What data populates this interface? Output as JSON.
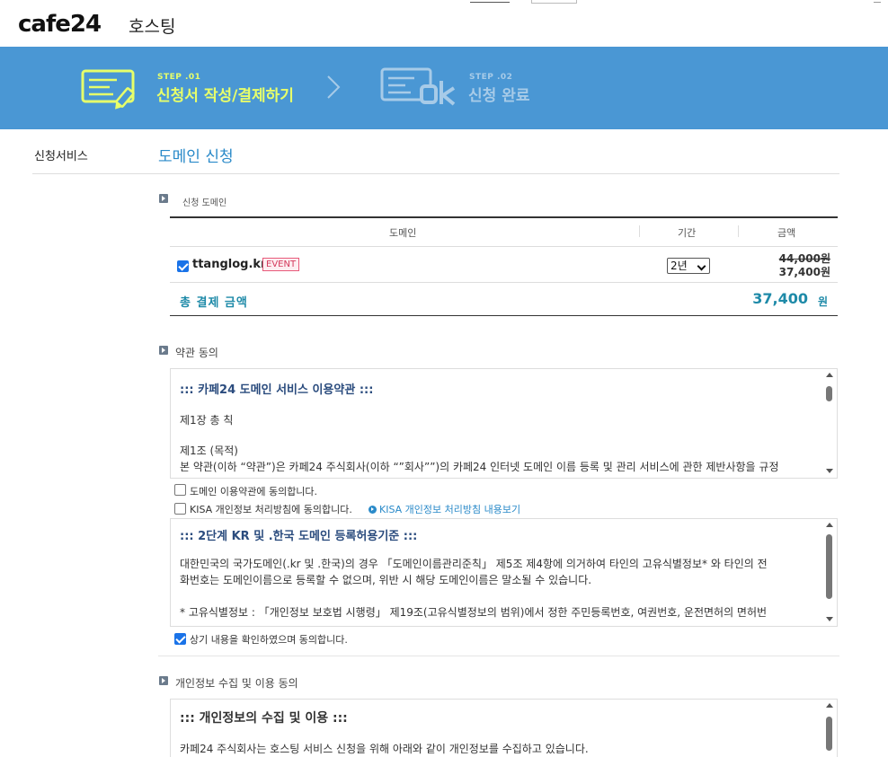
{
  "header": {
    "logo": "cafe24",
    "logo_sub": "호스팅"
  },
  "steps": [
    {
      "small": "STEP .01",
      "title": "신청서 작성/결제하기",
      "active": true
    },
    {
      "small": "STEP .02",
      "title": "신청 완료",
      "active": false
    }
  ],
  "sidebar": {
    "label": "신청서비스"
  },
  "section": {
    "title": "도메인 신청"
  },
  "domain_section": {
    "heading": "신청 도메인",
    "columns": [
      "도메인",
      "기간",
      "금액"
    ],
    "row": {
      "checked": true,
      "domain": "ttanglog.kr",
      "badge": "EVENT",
      "period": "2년",
      "price_original": "44,000원",
      "price_discount": "37,400원"
    },
    "total": {
      "label": "총 결제 금액",
      "value": "37,400",
      "unit": "원"
    }
  },
  "terms_section": {
    "heading": "약관 동의",
    "box1": {
      "title": "::: 카페24 도메인 서비스 이용약관 :::",
      "lines": [
        "제1장 총 칙",
        "제1조 (목적)",
        "본 약관(이하 “약관”)은 카페24 주식회사(이하 “”회사””)의 카페24 인터넷 도메인 이름 등록 및 관리 서비스에 관한 제반사항을 규정"
      ]
    },
    "agree1": {
      "label": "도메인 이용약관에 동의합니다.",
      "checked": false
    },
    "agree2": {
      "label": "KISA 개인정보 처리방침에 동의합니다.",
      "checked": false,
      "link": "KISA 개인정보 처리방침 내용보기"
    },
    "box2": {
      "title": "::: 2단계 KR 및 .한국 도메인 등록허용기준 :::",
      "lines": [
        "대한민국의 국가도메인(.kr 및 .한국)의 경우 「도메인이름관리준칙」 제5조 제4항에 의거하여 타인의 고유식별정보* 와 타인의 전",
        "화번호는 도메인이름으로 등록할 수 없으며, 위반 시 해당 도메인이름은 말소될 수 있습니다.",
        "* 고유식별정보 : 「개인정보 보호법 시행령」 제19조(고유식별정보의 범위)에서 정한 주민등록번호, 여권번호, 운전면허의 면허번"
      ]
    },
    "agree3": {
      "label": "상기 내용을 확인하였으며 동의합니다.",
      "checked": true
    }
  },
  "privacy_section": {
    "heading": "개인정보 수집 및 이용 동의",
    "box": {
      "title": "::: 개인정보의 수집 및 이용 :::",
      "lines": [
        "카페24 주식회사는 호스팅 서비스 신청을 위해 아래와 같이 개인정보를 수집하고 있습니다."
      ]
    }
  },
  "colors": {
    "banner": "#4a97d4",
    "active_step": "#e7ff6a",
    "inactive_step": "#a7cbe8",
    "accent": "#1e8aa8",
    "link": "#2a8ac9"
  }
}
